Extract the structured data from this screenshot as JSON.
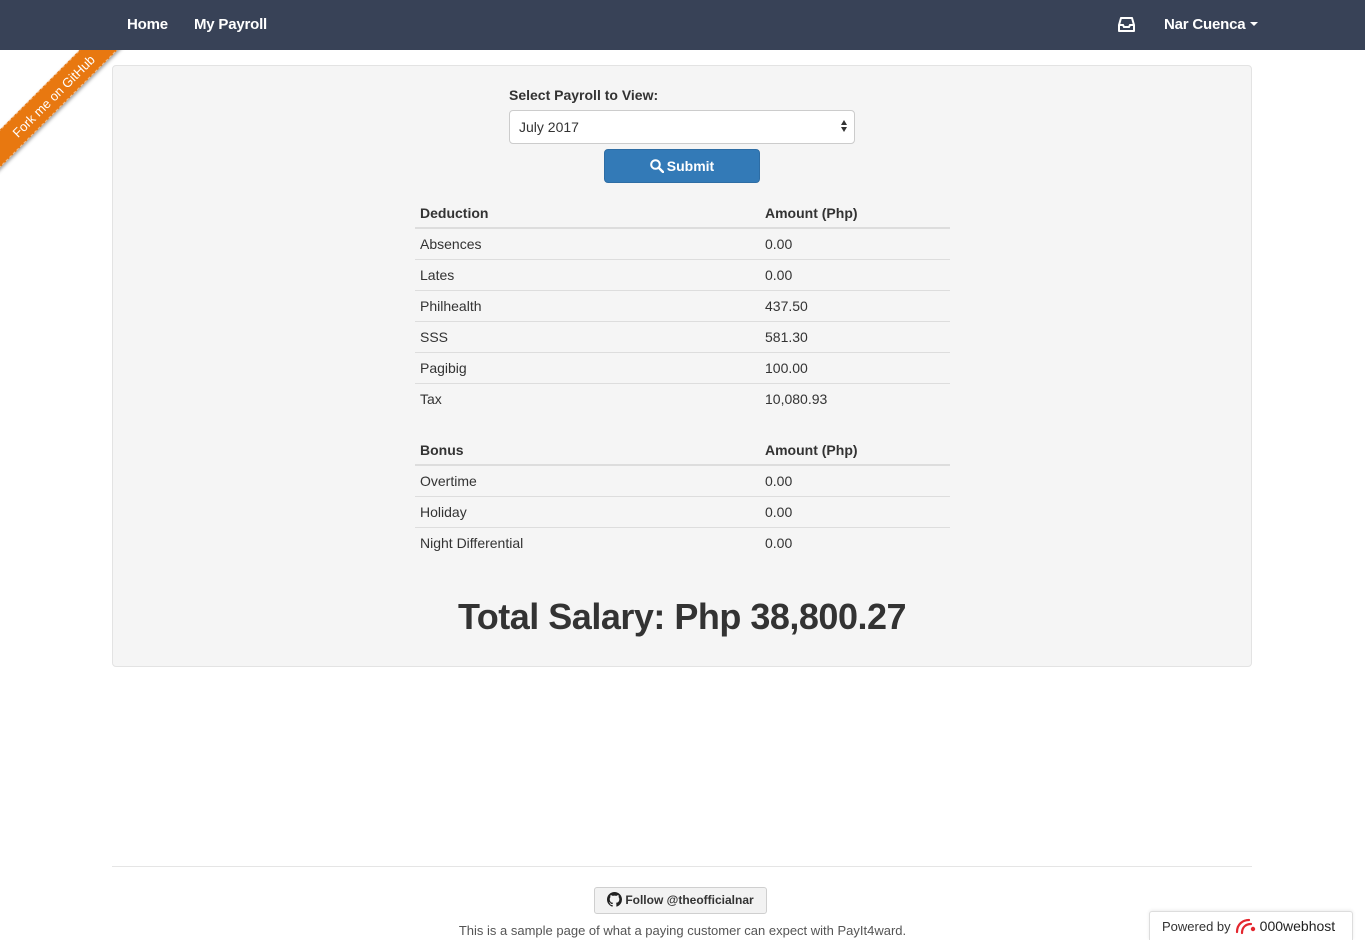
{
  "nav": {
    "home": "Home",
    "my_payroll": "My Payroll",
    "user_name": "Nar Cuenca",
    "inbox_icon": "inbox-icon"
  },
  "ribbon": {
    "label": "Fork me on GitHub",
    "color": "#e87810"
  },
  "payroll_form": {
    "label": "Select Payroll to View:",
    "selected": "July 2017",
    "submit_label": "Submit",
    "submit_icon": "search-icon"
  },
  "deductions": {
    "header_label": "Deduction",
    "header_amount": "Amount (Php)",
    "rows": [
      {
        "label": "Absences",
        "amount": "0.00"
      },
      {
        "label": "Lates",
        "amount": "0.00"
      },
      {
        "label": "Philhealth",
        "amount": "437.50"
      },
      {
        "label": "SSS",
        "amount": "581.30"
      },
      {
        "label": "Pagibig",
        "amount": "100.00"
      },
      {
        "label": "Tax",
        "amount": "10,080.93"
      }
    ]
  },
  "bonuses": {
    "header_label": "Bonus",
    "header_amount": "Amount (Php)",
    "rows": [
      {
        "label": "Overtime",
        "amount": "0.00"
      },
      {
        "label": "Holiday",
        "amount": "0.00"
      },
      {
        "label": "Night Differential",
        "amount": "0.00"
      }
    ]
  },
  "total": "Total Salary: Php 38,800.27",
  "footer": {
    "follow_label": "Follow @theofficialnar",
    "follow_icon": "github-icon",
    "text": "This is a sample page of what a paying customer can expect with PayIt4ward.",
    "powered_by": "Powered by",
    "host": "000webhost"
  },
  "colors": {
    "navbar": "#384257",
    "primary_button": "#337ab7",
    "panel": "#f5f5f5"
  }
}
